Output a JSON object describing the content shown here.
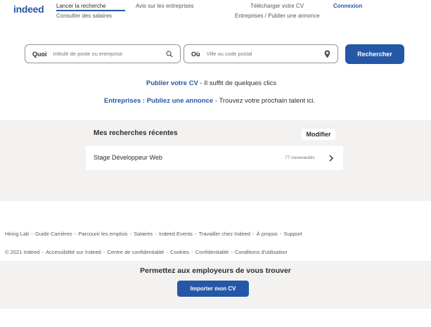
{
  "header": {
    "logo": "indeed",
    "nav": {
      "search": "Lancer la recherche",
      "salaries": "Consulter des salaires",
      "reviews": "Avis sur les entreprises",
      "upload_cv": "Télécharger votre CV",
      "employers": "Entreprises / Publier une annonce",
      "login": "Connexion"
    }
  },
  "search": {
    "what_label": "Quoi",
    "what_placeholder": "Intitulé de poste ou entreprise",
    "where_label": "Où",
    "where_placeholder": "Ville ou code postal",
    "button": "Rechercher"
  },
  "promos": {
    "cv_link": "Publier votre CV",
    "cv_text": " - Il suffit de quelques clics",
    "employer_link": "Entreprises : Publiez une annonce",
    "employer_text": " - Trouvez votre prochain talent ici."
  },
  "recent": {
    "title": "Mes recherches récentes",
    "edit": "Modifier",
    "items": [
      {
        "query": "Stage Développeur Web",
        "count": "77 nouveautés"
      }
    ]
  },
  "footer": {
    "links": [
      "Hiring Lab",
      "Guide Carrières",
      "Parcourir les emplois",
      "Salaires",
      "Indeed Events",
      "Travailler chez Indeed",
      "À propos",
      "Support"
    ],
    "legal": [
      "© 2021 Indeed",
      "Accessibilité sur Indeed",
      "Centre de confidentialité",
      "Cookies",
      "Confidentialité",
      "Conditions d'utilisation"
    ],
    "separator": " - "
  },
  "cta": {
    "title": "Permettez aux employeurs de vous trouver",
    "button": "Importer mon CV"
  },
  "colors": {
    "brand": "#2557a7",
    "panel": "#f3f2f1"
  }
}
